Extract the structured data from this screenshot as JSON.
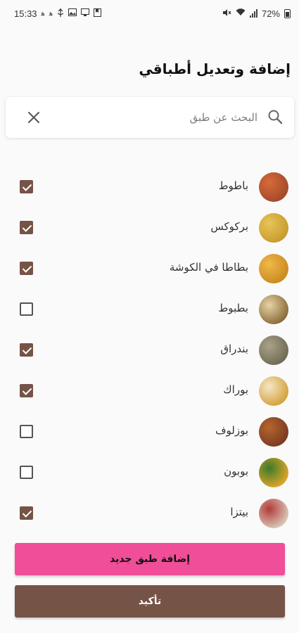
{
  "status_bar": {
    "time": "15:33",
    "left_icons": [
      "hijri-icon",
      "hijri-icon",
      "usb-icon",
      "image-icon",
      "screen-icon",
      "bookmark-icon"
    ],
    "battery_text": "72%"
  },
  "page": {
    "title": "إضافة وتعديل أطباقي"
  },
  "search": {
    "placeholder": "البحث عن طبق"
  },
  "dishes": [
    {
      "name": "باطوط",
      "checked": true,
      "thumb": "dish-photo",
      "colors": [
        "#a14a2a",
        "#d86a3a"
      ]
    },
    {
      "name": "بركوكس",
      "checked": true,
      "thumb": "dish-photo",
      "colors": [
        "#c79b2e",
        "#e8c45a"
      ]
    },
    {
      "name": "بطاطا في الكوشة",
      "checked": true,
      "thumb": "dish-photo",
      "colors": [
        "#c98a1f",
        "#f0b84a"
      ]
    },
    {
      "name": "بطبوط",
      "checked": false,
      "thumb": "dish-photo",
      "colors": [
        "#8b6a3a",
        "#e6d3a5"
      ]
    },
    {
      "name": "بندراق",
      "checked": true,
      "thumb": "dish-photo",
      "colors": [
        "#6f6a52",
        "#a9a38a"
      ]
    },
    {
      "name": "بوراك",
      "checked": true,
      "thumb": "dish-photo",
      "colors": [
        "#d3a23a",
        "#f5e6c8"
      ]
    },
    {
      "name": "بوزلوف",
      "checked": false,
      "thumb": "dish-photo",
      "colors": [
        "#7a3a22",
        "#b5652f"
      ]
    },
    {
      "name": "بوبون",
      "checked": false,
      "thumb": "dish-photo",
      "colors": [
        "#e0a52a",
        "#3a7a2a"
      ]
    },
    {
      "name": "بيتزا",
      "checked": true,
      "thumb": "dish-photo",
      "colors": [
        "#d8c9b8",
        "#b23a3a"
      ]
    }
  ],
  "buttons": {
    "add_label": "إضافة طبق جديد",
    "confirm_label": "تأكيد"
  },
  "colors": {
    "accent_brown": "#755346",
    "accent_pink": "#f04e98"
  }
}
